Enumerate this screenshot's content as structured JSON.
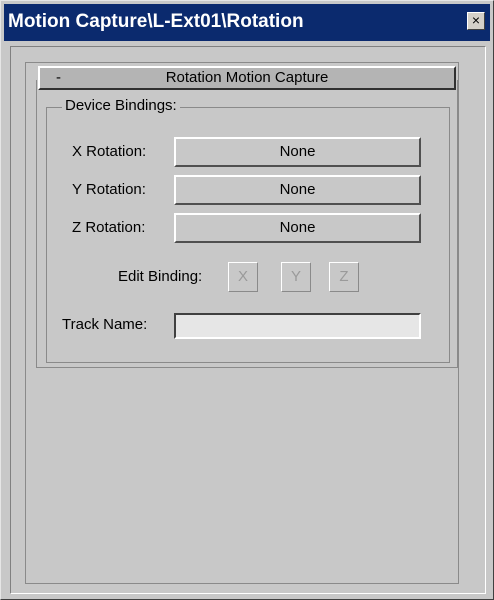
{
  "window": {
    "title": "Motion Capture\\L-Ext01\\Rotation",
    "close_glyph": "×"
  },
  "rollout": {
    "collapse_glyph": "-",
    "title": "Rotation Motion Capture"
  },
  "device_bindings": {
    "group_label": "Device Bindings:",
    "x_label": "X Rotation:",
    "x_value": "None",
    "y_label": "Y Rotation:",
    "y_value": "None",
    "z_label": "Z Rotation:",
    "z_value": "None",
    "edit_binding_label": "Edit Binding:",
    "edit_x": "X",
    "edit_y": "Y",
    "edit_z": "Z",
    "track_name_label": "Track Name:",
    "track_name_value": ""
  },
  "colors": {
    "titlebar": "#0b2a6e",
    "panel": "#c8c8c8",
    "rollout_header": "#b4b4b4"
  }
}
